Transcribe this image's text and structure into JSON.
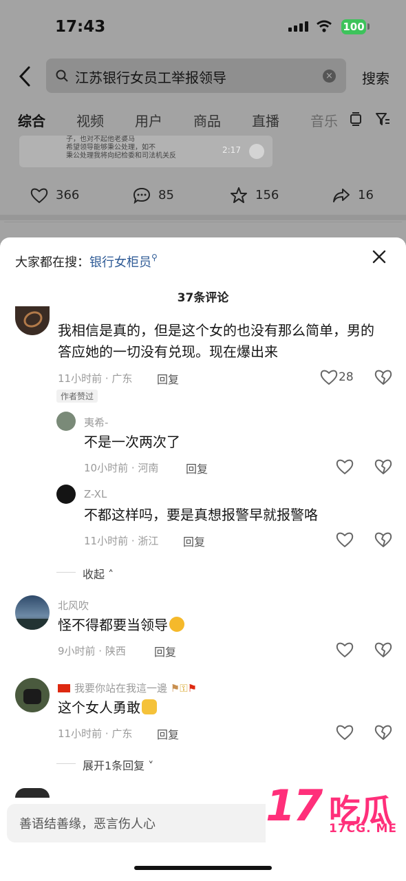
{
  "status_bar": {
    "time": "17:43",
    "battery": "100"
  },
  "search": {
    "query": "江苏银行女员工举报领导",
    "clear_icon": "×",
    "submit_label": "搜索"
  },
  "tabs": [
    {
      "label": "综合",
      "active": true
    },
    {
      "label": "视频"
    },
    {
      "label": "用户"
    },
    {
      "label": "商品"
    },
    {
      "label": "直播"
    },
    {
      "label": "音乐"
    }
  ],
  "video_card": {
    "snippet_lines": [
      "子，也对不起他老婆马",
      "希望领导能够秉公处理，如不",
      "秉公处理我将向纪检委和司法机关反"
    ],
    "duration": "2:17"
  },
  "post_actions": {
    "likes": "366",
    "comments": "85",
    "favorites": "156",
    "shares": "16"
  },
  "sheet": {
    "trending_prefix": "大家都在搜：",
    "trending_keyword": "银行女柜员",
    "trending_icon": "search-icon",
    "comment_count": "37条评论"
  },
  "comments": [
    {
      "text_lines": [
        "我相信是真的，但是这个女的也没有那么简单，男的",
        "答应她的一切没有兑现。现在爆出来"
      ],
      "meta": "11小时前 · 广东",
      "reply_label": "回复",
      "likes": "28",
      "badge": "作者赞过",
      "replies": [
        {
          "user": "夷希-",
          "text": "不是一次两次了",
          "meta": "10小时前 · 河南",
          "reply_label": "回复"
        },
        {
          "user": "Z-XL",
          "text": "不都这样吗，要是真想报警早就报警咯",
          "meta": "11小时前 · 浙江",
          "reply_label": "回复"
        }
      ],
      "collapse_label": "收起"
    },
    {
      "user": "北风吹",
      "text": "怪不得都要当领导",
      "meta": "9小时前 · 陕西",
      "reply_label": "回复"
    },
    {
      "user": "我要你站在我這一邊",
      "text": "这个女人勇敢",
      "meta": "11小时前 · 广东",
      "reply_label": "回复",
      "expand_label": "展开1条回复"
    }
  ],
  "input": {
    "placeholder": "善语结善缘，恶言伤人心"
  },
  "watermark": {
    "big": "17",
    "chinese": "吃瓜",
    "domain": "17CG. ME"
  }
}
